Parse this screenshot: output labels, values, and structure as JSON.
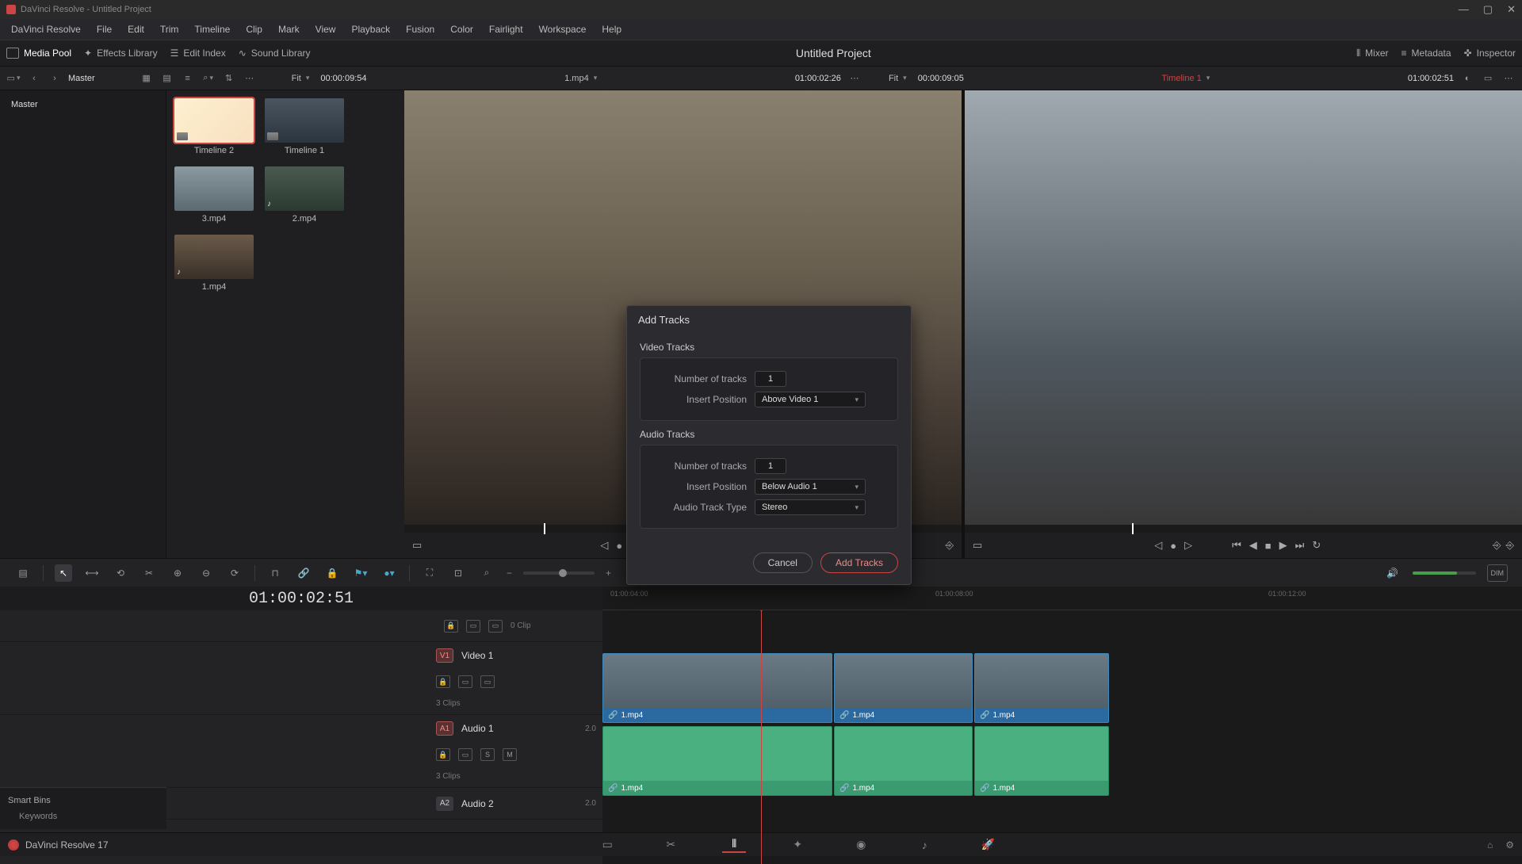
{
  "window_title": "DaVinci Resolve - Untitled Project",
  "menu": [
    "DaVinci Resolve",
    "File",
    "Edit",
    "Trim",
    "Timeline",
    "Clip",
    "Mark",
    "View",
    "Playback",
    "Fusion",
    "Color",
    "Fairlight",
    "Workspace",
    "Help"
  ],
  "panels": {
    "media_pool": "Media Pool",
    "effects_library": "Effects Library",
    "edit_index": "Edit Index",
    "sound_library": "Sound Library",
    "mixer": "Mixer",
    "metadata": "Metadata",
    "inspector": "Inspector"
  },
  "project_title": "Untitled Project",
  "toolrow": {
    "master": "Master",
    "source_fit": "Fit",
    "source_tc": "00:00:09:54",
    "source_name": "1.mp4",
    "source_tc_right": "01:00:02:26",
    "timeline_fit": "Fit",
    "timeline_tc": "00:00:09:05",
    "timeline_name": "Timeline 1",
    "timeline_tc_right": "01:00:02:51"
  },
  "bin": {
    "master": "Master"
  },
  "clips": [
    {
      "name": "Timeline 2"
    },
    {
      "name": "Timeline 1"
    },
    {
      "name": "3.mp4"
    },
    {
      "name": "2.mp4"
    },
    {
      "name": "1.mp4"
    }
  ],
  "timeline": {
    "current_tc": "01:00:02:51",
    "ruler": [
      "01:00:04:00",
      "01:00:08:00",
      "01:00:12:00"
    ],
    "tracks": {
      "v2_count": "0 Clip",
      "v1_badge": "V1",
      "v1_name": "Video 1",
      "v1_count": "3 Clips",
      "a1_badge": "A1",
      "a1_name": "Audio 1",
      "a1_ch": "2.0",
      "a1_count": "3 Clips",
      "a2_badge": "A2",
      "a2_name": "Audio 2",
      "a2_ch": "2.0"
    },
    "clip_label": "1.mp4"
  },
  "dialog": {
    "title": "Add Tracks",
    "video_section": "Video Tracks",
    "audio_section": "Audio Tracks",
    "num_tracks_label": "Number of tracks",
    "insert_pos_label": "Insert Position",
    "audio_type_label": "Audio Track Type",
    "video_count": "1",
    "video_pos": "Above Video 1",
    "audio_count": "1",
    "audio_pos": "Below Audio 1",
    "audio_type": "Stereo",
    "cancel": "Cancel",
    "add": "Add Tracks"
  },
  "smart_bins": {
    "header": "Smart Bins",
    "keywords": "Keywords"
  },
  "app_name": "DaVinci Resolve 17"
}
